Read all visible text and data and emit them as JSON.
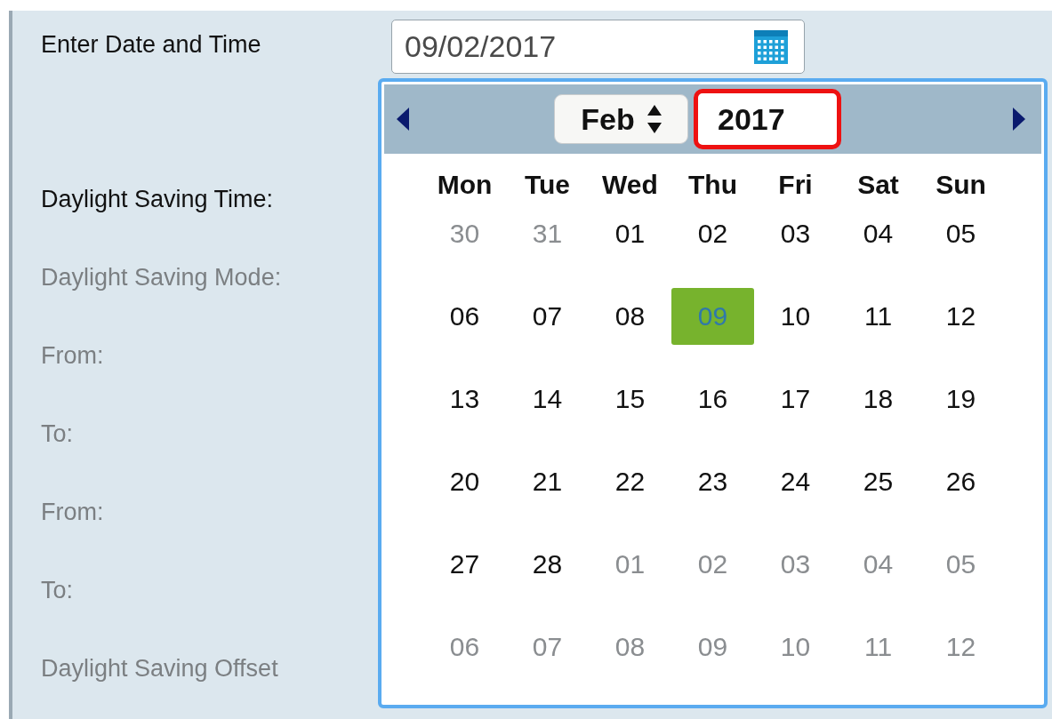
{
  "form": {
    "labels": [
      {
        "text": "Enter Date and Time",
        "disabled": false
      },
      {
        "text": "Daylight Saving Time:",
        "disabled": false
      },
      {
        "text": "Daylight Saving Mode:",
        "disabled": true
      },
      {
        "text": "From:",
        "disabled": true
      },
      {
        "text": "To:",
        "disabled": true
      },
      {
        "text": "From:",
        "disabled": true
      },
      {
        "text": "To:",
        "disabled": true
      },
      {
        "text": "Daylight Saving Offset",
        "disabled": true
      }
    ],
    "date_field": {
      "value": "09/02/2017"
    }
  },
  "calendar": {
    "month": "Feb",
    "year": "2017",
    "year_highlighted": true,
    "weekdays": [
      "Mon",
      "Tue",
      "Wed",
      "Thu",
      "Fri",
      "Sat",
      "Sun"
    ],
    "weeks": [
      [
        {
          "day": "30",
          "in_month": false,
          "selected": false
        },
        {
          "day": "31",
          "in_month": false,
          "selected": false
        },
        {
          "day": "01",
          "in_month": true,
          "selected": false
        },
        {
          "day": "02",
          "in_month": true,
          "selected": false
        },
        {
          "day": "03",
          "in_month": true,
          "selected": false
        },
        {
          "day": "04",
          "in_month": true,
          "selected": false
        },
        {
          "day": "05",
          "in_month": true,
          "selected": false
        }
      ],
      [
        {
          "day": "06",
          "in_month": true,
          "selected": false
        },
        {
          "day": "07",
          "in_month": true,
          "selected": false
        },
        {
          "day": "08",
          "in_month": true,
          "selected": false
        },
        {
          "day": "09",
          "in_month": true,
          "selected": true
        },
        {
          "day": "10",
          "in_month": true,
          "selected": false
        },
        {
          "day": "11",
          "in_month": true,
          "selected": false
        },
        {
          "day": "12",
          "in_month": true,
          "selected": false
        }
      ],
      [
        {
          "day": "13",
          "in_month": true,
          "selected": false
        },
        {
          "day": "14",
          "in_month": true,
          "selected": false
        },
        {
          "day": "15",
          "in_month": true,
          "selected": false
        },
        {
          "day": "16",
          "in_month": true,
          "selected": false
        },
        {
          "day": "17",
          "in_month": true,
          "selected": false
        },
        {
          "day": "18",
          "in_month": true,
          "selected": false
        },
        {
          "day": "19",
          "in_month": true,
          "selected": false
        }
      ],
      [
        {
          "day": "20",
          "in_month": true,
          "selected": false
        },
        {
          "day": "21",
          "in_month": true,
          "selected": false
        },
        {
          "day": "22",
          "in_month": true,
          "selected": false
        },
        {
          "day": "23",
          "in_month": true,
          "selected": false
        },
        {
          "day": "24",
          "in_month": true,
          "selected": false
        },
        {
          "day": "25",
          "in_month": true,
          "selected": false
        },
        {
          "day": "26",
          "in_month": true,
          "selected": false
        }
      ],
      [
        {
          "day": "27",
          "in_month": true,
          "selected": false
        },
        {
          "day": "28",
          "in_month": true,
          "selected": false
        },
        {
          "day": "01",
          "in_month": false,
          "selected": false
        },
        {
          "day": "02",
          "in_month": false,
          "selected": false
        },
        {
          "day": "03",
          "in_month": false,
          "selected": false
        },
        {
          "day": "04",
          "in_month": false,
          "selected": false
        },
        {
          "day": "05",
          "in_month": false,
          "selected": false
        }
      ],
      [
        {
          "day": "06",
          "in_month": false,
          "selected": false
        },
        {
          "day": "07",
          "in_month": false,
          "selected": false
        },
        {
          "day": "08",
          "in_month": false,
          "selected": false
        },
        {
          "day": "09",
          "in_month": false,
          "selected": false
        },
        {
          "day": "10",
          "in_month": false,
          "selected": false
        },
        {
          "day": "11",
          "in_month": false,
          "selected": false
        },
        {
          "day": "12",
          "in_month": false,
          "selected": false
        }
      ]
    ]
  }
}
